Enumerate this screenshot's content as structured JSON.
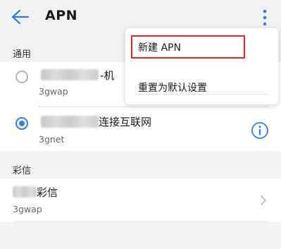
{
  "header": {
    "back_icon": "back-arrow-icon",
    "title": "APN",
    "more_icon": "more-vertical-icon"
  },
  "sections": [
    {
      "label": "通用",
      "items": [
        {
          "title_visible": "-机",
          "subtitle": "3gwap",
          "selected": false
        },
        {
          "title_visible": "连接互联网",
          "subtitle": "3gnet",
          "selected": true,
          "trailing_icon": "info-icon"
        }
      ]
    },
    {
      "label": "彩信",
      "items": [
        {
          "title_visible": "彩信",
          "subtitle": "3gwap",
          "trailing_icon": "chevron-right-icon"
        }
      ]
    }
  ],
  "menu": {
    "items": [
      "新建 APN",
      "重置为默认设置"
    ],
    "highlighted_index": 0,
    "highlight_color": "#e0282a"
  },
  "colors": {
    "accent": "#2d7ff0",
    "background": "#f2f2f2"
  }
}
